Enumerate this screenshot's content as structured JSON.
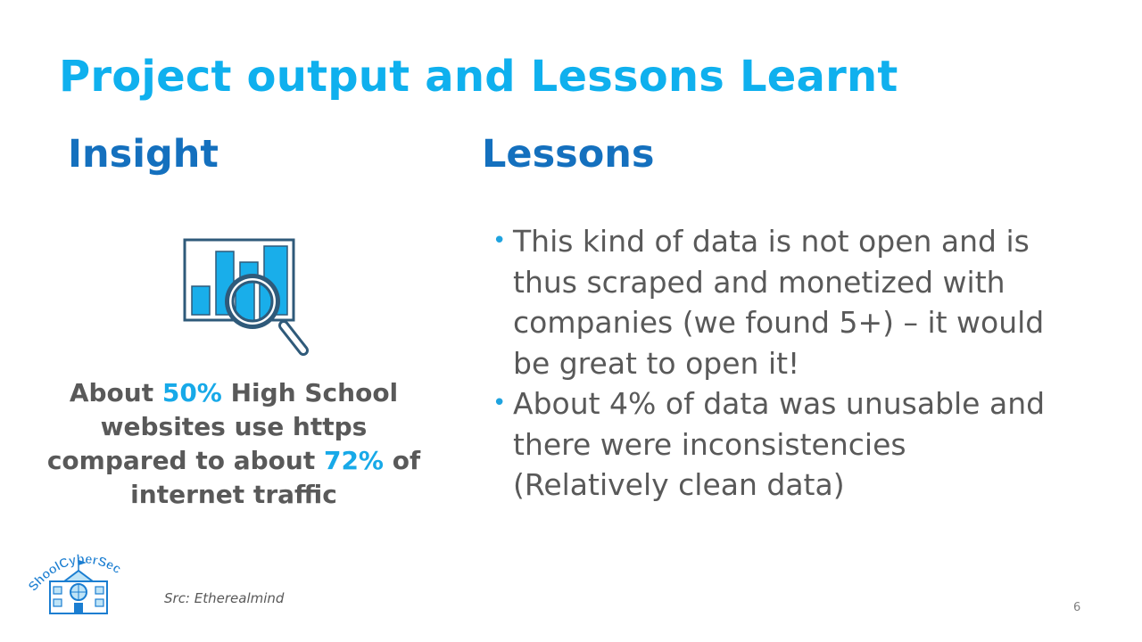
{
  "slide": {
    "title": "Project output and Lessons Learnt",
    "page_number": "6",
    "source": "Src: Etherealmind"
  },
  "insight": {
    "heading": "Insight",
    "icon": "chart-magnifier-icon",
    "text_parts": {
      "p1": "About ",
      "h1": "50%",
      "p2": " High School websites use https compared to about ",
      "h2": "72%",
      "p3": " of internet traffic"
    }
  },
  "lessons": {
    "heading": "Lessons",
    "items": [
      "This kind of data is not open and is thus scraped and monetized with companies (we found 5+) – it would be great to open it!",
      "About 4% of data was unusable and there were inconsistencies (Relatively clean data)"
    ]
  },
  "logo": {
    "text": "ShoolCyberSec",
    "icon": "school-building-icon"
  },
  "colors": {
    "title": "#0fb0ee",
    "heading": "#1470be",
    "highlight": "#17a9e8",
    "body_text": "#595959",
    "icon_outline": "#2f5a7a"
  }
}
